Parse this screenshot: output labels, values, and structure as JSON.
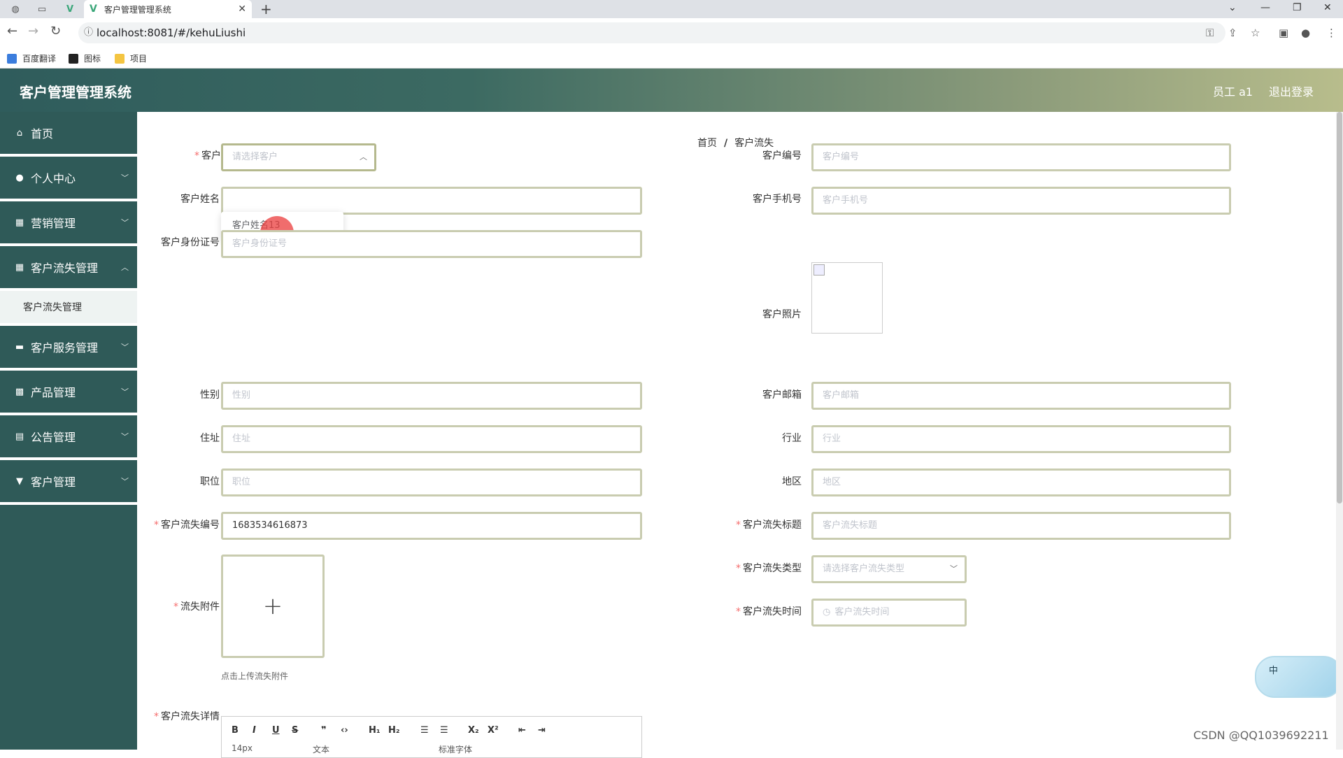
{
  "browser": {
    "tab_title": "客户管理管理系统",
    "tab_logo": "V",
    "url": "localhost:8081/#/kehuLiushi",
    "bookmarks": [
      "百度翻译",
      "图标",
      "项目"
    ]
  },
  "header": {
    "title": "客户管理管理系统",
    "user": "员工 a1",
    "logout": "退出登录"
  },
  "sidebar": {
    "items": [
      {
        "label": "首页",
        "icon": "home-icon"
      },
      {
        "label": "个人中心",
        "icon": "user-icon"
      },
      {
        "label": "营销管理",
        "icon": "grid-icon"
      },
      {
        "label": "客户流失管理",
        "icon": "grid-icon"
      },
      {
        "label": "客户服务管理",
        "icon": "monitor-icon"
      },
      {
        "label": "产品管理",
        "icon": "apps-icon"
      },
      {
        "label": "公告管理",
        "icon": "doc-icon"
      },
      {
        "label": "客户管理",
        "icon": "flag-icon"
      }
    ],
    "submenu": "客户流失管理"
  },
  "breadcrumb": {
    "home": "首页",
    "sep": "/",
    "current": "客户流失"
  },
  "form": {
    "customer": {
      "label": "客户",
      "placeholder": "请选择客户",
      "dropdown_option": "客户姓名13"
    },
    "customer_no": {
      "label": "客户编号",
      "placeholder": "客户编号"
    },
    "customer_name": {
      "label": "客户姓名"
    },
    "customer_phone": {
      "label": "客户手机号",
      "placeholder": "客户手机号"
    },
    "id_card": {
      "label": "客户身份证号",
      "placeholder": "客户身份证号"
    },
    "photo": {
      "label": "客户照片"
    },
    "gender": {
      "label": "性别",
      "placeholder": "性别"
    },
    "email": {
      "label": "客户邮箱",
      "placeholder": "客户邮箱"
    },
    "address": {
      "label": "住址",
      "placeholder": "住址"
    },
    "industry": {
      "label": "行业",
      "placeholder": "行业"
    },
    "position": {
      "label": "职位",
      "placeholder": "职位"
    },
    "region": {
      "label": "地区",
      "placeholder": "地区"
    },
    "loss_no": {
      "label": "客户流失编号",
      "value": "1683534616873"
    },
    "loss_title": {
      "label": "客户流失标题",
      "placeholder": "客户流失标题"
    },
    "loss_attachment": {
      "label": "流失附件",
      "hint": "点击上传流失附件"
    },
    "loss_type": {
      "label": "客户流失类型",
      "placeholder": "请选择客户流失类型"
    },
    "loss_time": {
      "label": "客户流失时间",
      "placeholder": "客户流失时间"
    },
    "loss_detail": {
      "label": "客户流失详情"
    }
  },
  "editor": {
    "font_size": "14px",
    "text_style": "文本",
    "font_family": "标准字体"
  },
  "widget": {
    "label": "中"
  },
  "watermark": "CSDN @QQ1039692211"
}
